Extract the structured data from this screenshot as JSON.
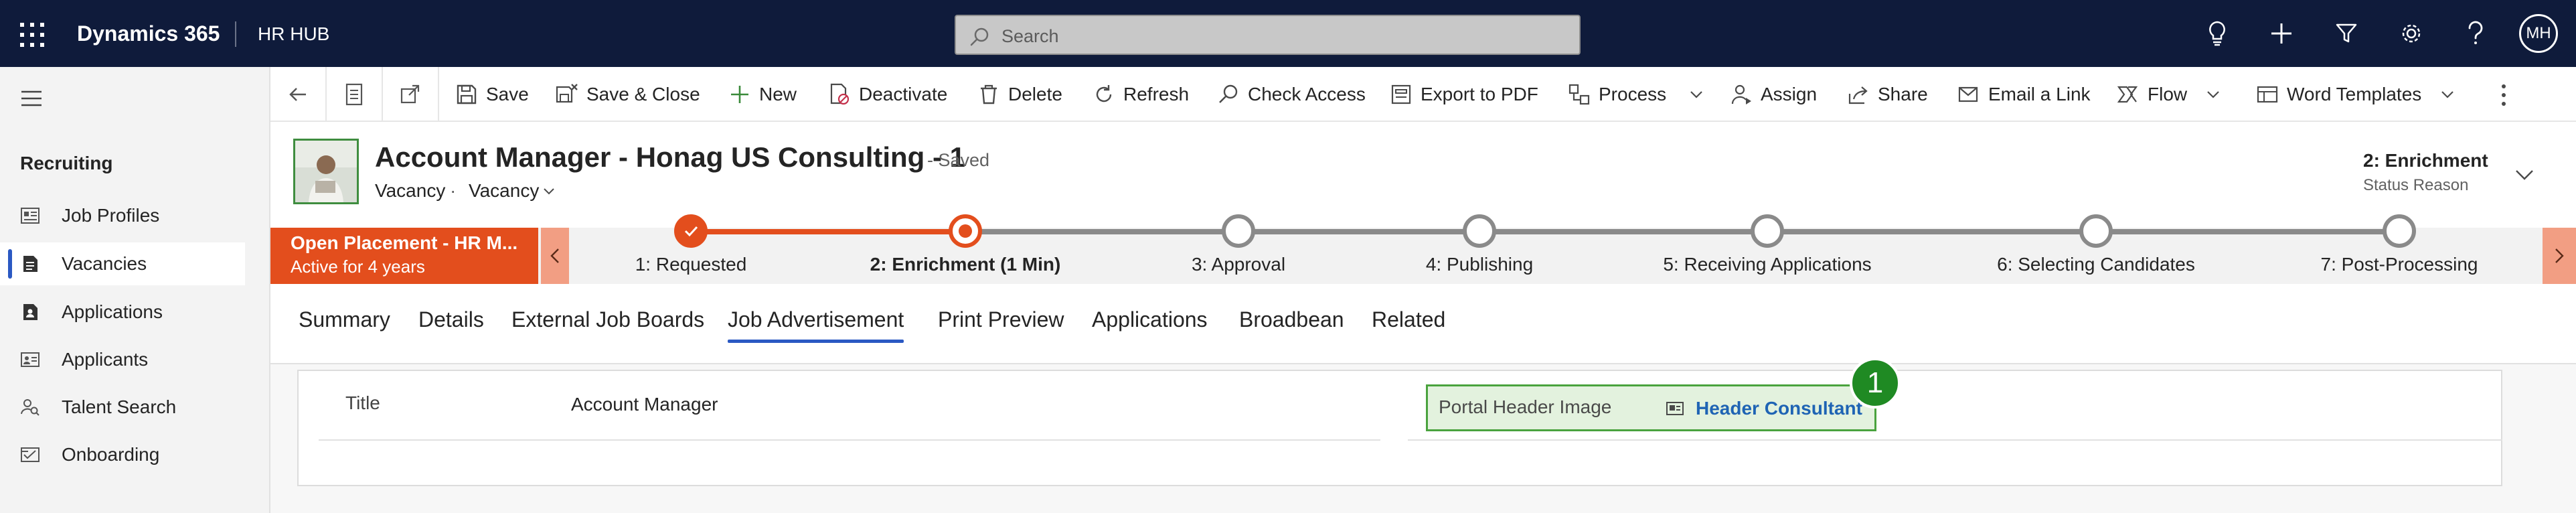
{
  "topbar": {
    "app_name": "Dynamics 365",
    "area_name": "HR HUB",
    "search_placeholder": "Search",
    "icons": [
      "lightbulb-icon",
      "plus-icon",
      "filter-icon",
      "gear-icon",
      "help-icon"
    ],
    "user_initials": "MH"
  },
  "nav": {
    "group_label": "Recruiting",
    "items": [
      {
        "label": "Job Profiles",
        "icon": "job-profiles-icon"
      },
      {
        "label": "Vacancies",
        "icon": "vacancies-icon",
        "active": true
      },
      {
        "label": "Applications",
        "icon": "applications-icon"
      },
      {
        "label": "Applicants",
        "icon": "applicants-icon"
      },
      {
        "label": "Talent Search",
        "icon": "talent-search-icon"
      },
      {
        "label": "Onboarding",
        "icon": "onboarding-icon"
      }
    ]
  },
  "commands": {
    "save": "Save",
    "save_close": "Save & Close",
    "new": "New",
    "deactivate": "Deactivate",
    "delete": "Delete",
    "refresh": "Refresh",
    "check_access": "Check Access",
    "export_pdf": "Export to PDF",
    "process": "Process",
    "assign": "Assign",
    "share": "Share",
    "email_link": "Email a Link",
    "flow": "Flow",
    "word_templates": "Word Templates"
  },
  "record": {
    "title": "Account Manager - Honag US Consulting - 1",
    "save_status": "- Saved",
    "entity": "Vacancy",
    "separator": "·",
    "form_name": "Vacancy",
    "header_field_value": "2: Enrichment",
    "header_field_label": "Status Reason"
  },
  "bpf": {
    "active_name": "Open Placement - HR M...",
    "active_duration": "Active for 4 years",
    "stages": [
      {
        "label": "1: Requested",
        "status": "completed"
      },
      {
        "label": "2: Enrichment  (1 Min)",
        "status": "current"
      },
      {
        "label": "3: Approval",
        "status": "pending"
      },
      {
        "label": "4: Publishing",
        "status": "pending"
      },
      {
        "label": "5: Receiving Applications",
        "status": "pending"
      },
      {
        "label": "6: Selecting Candidates",
        "status": "pending"
      },
      {
        "label": "7: Post-Processing",
        "status": "pending"
      }
    ]
  },
  "tabs": [
    {
      "label": "Summary"
    },
    {
      "label": "Details"
    },
    {
      "label": "External Job Boards"
    },
    {
      "label": "Job Advertisement",
      "active": true
    },
    {
      "label": "Print Preview"
    },
    {
      "label": "Applications"
    },
    {
      "label": "Broadbean"
    },
    {
      "label": "Related"
    }
  ],
  "form": {
    "title_label": "Title",
    "title_value": "Account Manager",
    "portal_image_label": "Portal Header Image",
    "portal_image_value": "Header Consultant",
    "callout_number": "1"
  },
  "colors": {
    "topbar": "#0f1b3b",
    "accent_blue": "#2b59c3",
    "bpf_active": "#e34e1d",
    "bpf_progress": "#e34e1d",
    "highlight_green": "#4aa33e",
    "callout_green": "#1f8a23",
    "link_blue": "#1f64b4"
  }
}
